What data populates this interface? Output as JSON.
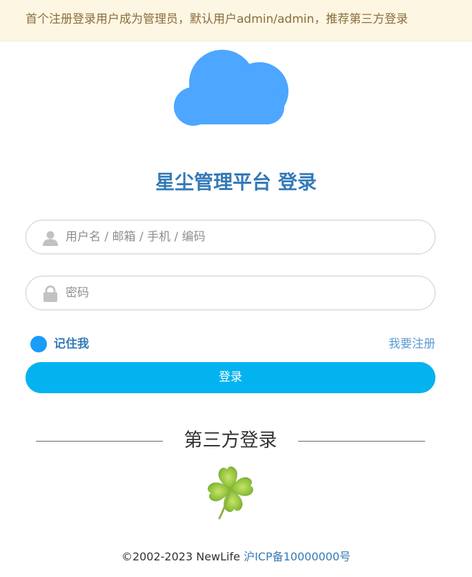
{
  "notice": {
    "text": "首个注册登录用户成为管理员，默认用户admin/admin，推荐第三方登录"
  },
  "logo": {
    "icon": "cloud-icon",
    "color": "#4da6ff"
  },
  "title": "星尘管理平台 登录",
  "form": {
    "username_placeholder": "用户名 / 邮箱 / 手机 / 编码",
    "username_value": "",
    "password_placeholder": "密码",
    "password_value": "",
    "remember_label": "记住我",
    "remember_checked": true,
    "register_link": "我要注册",
    "login_button": "登录"
  },
  "third_party": {
    "title": "第三方登录",
    "providers": [
      {
        "icon": "clover-icon"
      }
    ]
  },
  "footer": {
    "copyright": "©2002-2023 NewLife",
    "icp": "沪ICP备10000000号"
  },
  "colors": {
    "notice_bg": "#fdf6e3",
    "notice_text": "#8a6d3b",
    "title": "#337ab7",
    "button": "#03b3ef",
    "remember_dot": "#1a9cf8",
    "link": "#5b9bd5"
  }
}
